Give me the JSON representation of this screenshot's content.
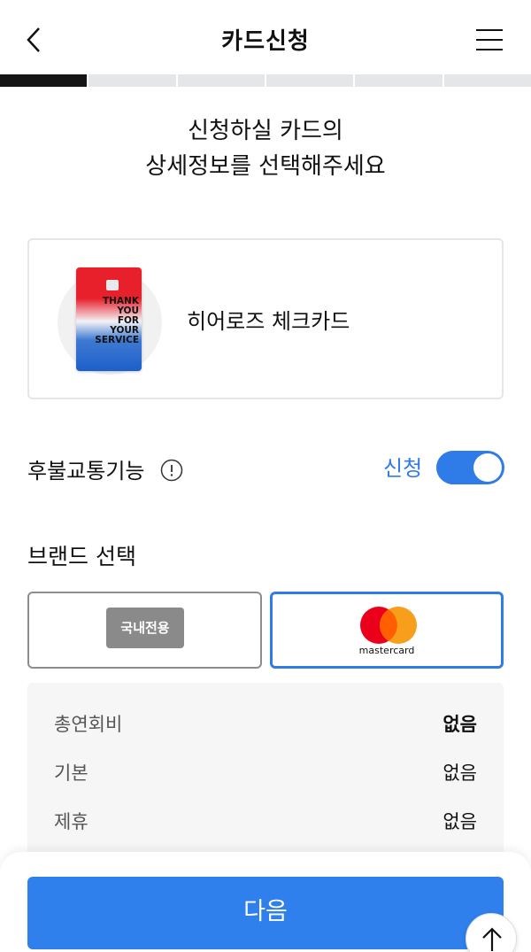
{
  "header": {
    "title": "카드신청"
  },
  "progress": {
    "total_steps": 6,
    "current_step": 1
  },
  "intro": {
    "line1": "신청하실 카드의",
    "line2": "상세정보를 선택해주세요"
  },
  "card": {
    "name": "히어로즈 체크카드",
    "art_text": [
      "THANK",
      "YOU",
      "FOR",
      "YOUR",
      "SERVICE"
    ]
  },
  "transit": {
    "label": "후불교통기능",
    "status": "신청",
    "enabled": true
  },
  "brand": {
    "label": "브랜드 선택",
    "options": [
      {
        "label": "국내전용",
        "selected": false
      },
      {
        "label": "mastercard",
        "selected": true
      }
    ]
  },
  "fees": [
    {
      "label": "총연회비",
      "value": "없음"
    },
    {
      "label": "기본",
      "value": "없음"
    },
    {
      "label": "제휴",
      "value": "없음"
    }
  ],
  "footer": {
    "next_label": "다음"
  },
  "colors": {
    "accent": "#2f80ed",
    "progress_active": "#151515",
    "mc_red": "#eb001b",
    "mc_orange": "#f79e1b"
  },
  "icons": {
    "back": "chevron-left-icon",
    "menu": "hamburger-menu-icon",
    "info": "info-icon",
    "scroll_top": "arrow-up-icon"
  }
}
